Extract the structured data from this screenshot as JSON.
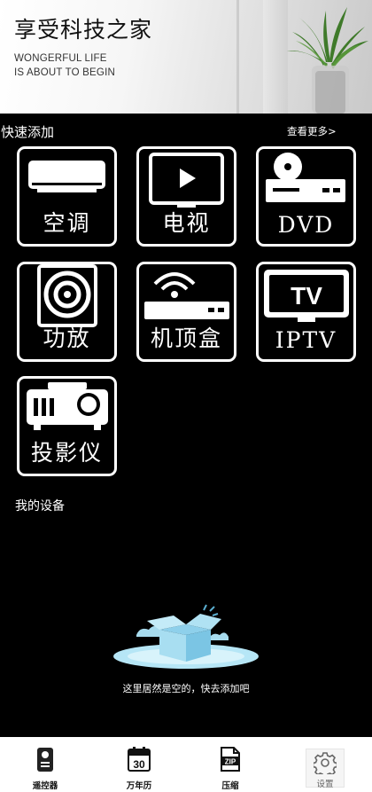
{
  "header": {
    "title": "享受科技之家",
    "subtitle_line1": "WONGERFUL LIFE",
    "subtitle_line2": "IS ABOUT TO BEGIN"
  },
  "quick_add": {
    "label": "快速添加",
    "more_label": "查看更多>",
    "tiles": [
      {
        "label": "空调",
        "icon": "air-conditioner-icon"
      },
      {
        "label": "电视",
        "icon": "tv-play-icon"
      },
      {
        "label": "DVD",
        "icon": "dvd-player-icon"
      },
      {
        "label": "功放",
        "icon": "speaker-icon"
      },
      {
        "label": "机顶盒",
        "icon": "set-top-box-icon"
      },
      {
        "label": "IPTV",
        "icon": "iptv-icon"
      },
      {
        "label": "投影仪",
        "icon": "projector-icon"
      }
    ]
  },
  "my_devices": {
    "label": "我的设备",
    "empty_text": "这里居然是空的，快去添加吧"
  },
  "nav": {
    "items": [
      {
        "label": "遥控器",
        "icon": "remote-icon"
      },
      {
        "label": "万年历",
        "icon": "calendar-icon",
        "calendar_day": "30"
      },
      {
        "label": "压缩",
        "icon": "zip-file-icon",
        "zip_text": "ZIP"
      },
      {
        "label": "设置",
        "icon": "gear-icon"
      }
    ]
  }
}
